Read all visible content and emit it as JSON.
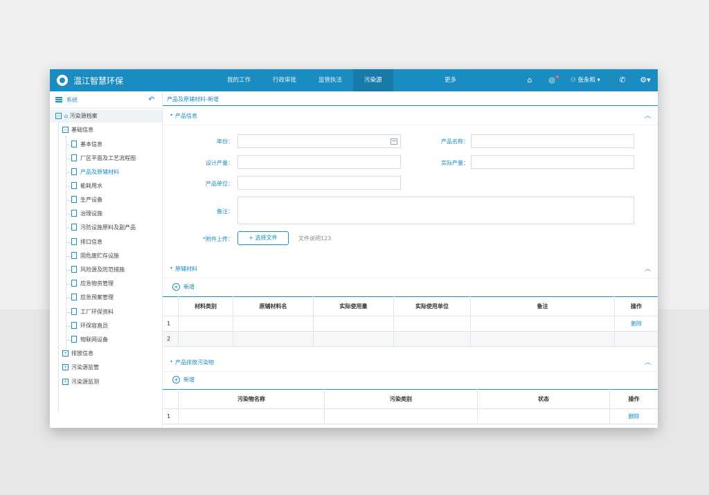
{
  "header": {
    "title": "温江智慧环保",
    "nav": [
      "我的工作",
      "行政审批",
      "监管执法",
      "污染源"
    ],
    "nav_active": "污染源",
    "more": "更多",
    "user": "张永和"
  },
  "sidebar": {
    "title": "系统",
    "root": "污染源档案",
    "group": "基础信息",
    "items": [
      "基本信息",
      "厂区平面及工艺流程图",
      "产品及原辅材料",
      "能耗用水",
      "生产设备",
      "治理设施",
      "污防设施原料及副产品",
      "排口信息",
      "固危废贮存设施",
      "风险源及防范措施",
      "应急物资管理",
      "应急预案管理",
      "工厂环保资料",
      "环保容直员",
      "物联网设备"
    ],
    "active_item": "产品及原辅材料",
    "others": [
      "排放信息",
      "污染源监管",
      "污染源监测"
    ]
  },
  "main": {
    "breadcrumb": "产品及原辅材料-新增",
    "product_section": {
      "title": "产品信息",
      "labels": {
        "year": "年份：",
        "name": "产品名称：",
        "design": "设计产量：",
        "actual": "实际产量：",
        "unit": "产品单位：",
        "note": "备注：",
        "attach": "*附件上传："
      },
      "upload_button": "+ 选择文件",
      "upload_note": "文件说明123"
    },
    "raw_section": {
      "title": "原辅材料",
      "add": "新增",
      "columns": [
        "",
        "材料类别",
        "原辅材料名",
        "实际使用量",
        "实际使用单位",
        "备注",
        "操作"
      ],
      "rows": [
        {
          "idx": "1",
          "op": "删除"
        },
        {
          "idx": "2",
          "op": ""
        }
      ]
    },
    "pollutant_section": {
      "title": "产品排放污染物",
      "add": "新增",
      "columns": [
        "",
        "污染物名称",
        "污染类别",
        "状态",
        "操作"
      ],
      "rows": [
        {
          "idx": "1",
          "op": "删除"
        }
      ]
    }
  }
}
